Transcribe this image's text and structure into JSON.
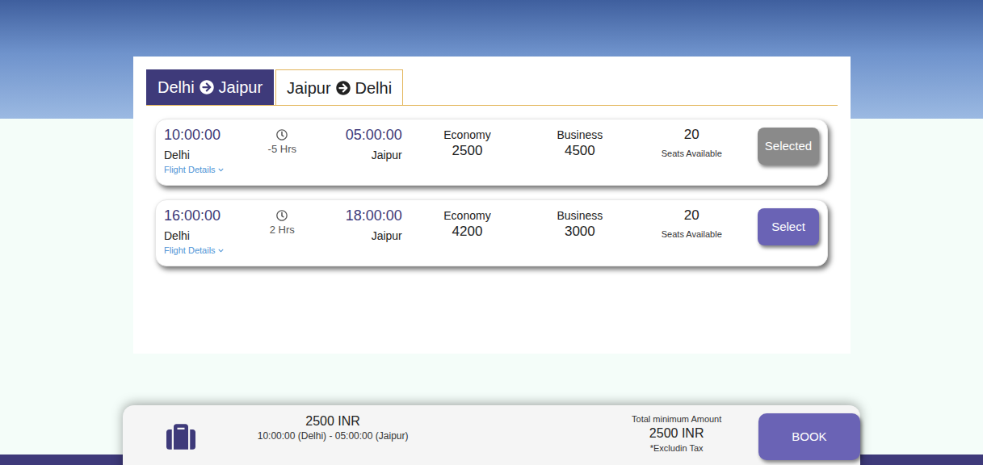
{
  "tabs": [
    {
      "from": "Delhi",
      "to": "Jaipur",
      "selected": true
    },
    {
      "from": "Jaipur",
      "to": "Delhi",
      "selected": false
    }
  ],
  "flights": [
    {
      "departTime": "10:00:00",
      "departCity": "Delhi",
      "duration": "-5 Hrs",
      "arriveTime": "05:00:00",
      "arriveCity": "Jaipur",
      "details": "Flight Details",
      "economyLabel": "Economy",
      "economyPrice": "2500",
      "businessLabel": "Business",
      "businessPrice": "4500",
      "seats": "20",
      "seatsLabel": "Seats Available",
      "button": "Selected",
      "selected": true
    },
    {
      "departTime": "16:00:00",
      "departCity": "Delhi",
      "duration": "2 Hrs",
      "arriveTime": "18:00:00",
      "arriveCity": "Jaipur",
      "details": "Flight Details",
      "economyLabel": "Economy",
      "economyPrice": "4200",
      "businessLabel": "Business",
      "businessPrice": "3000",
      "seats": "20",
      "seatsLabel": "Seats Available",
      "button": "Select",
      "selected": false
    }
  ],
  "summary": {
    "price": "2500 INR",
    "route": "10:00:00 (Delhi) - 05:00:00 (Jaipur)",
    "totalLabel": "Total minimum Amount",
    "totalAmount": "2500 INR",
    "note": "*Excludin Tax",
    "book": "BOOK"
  }
}
